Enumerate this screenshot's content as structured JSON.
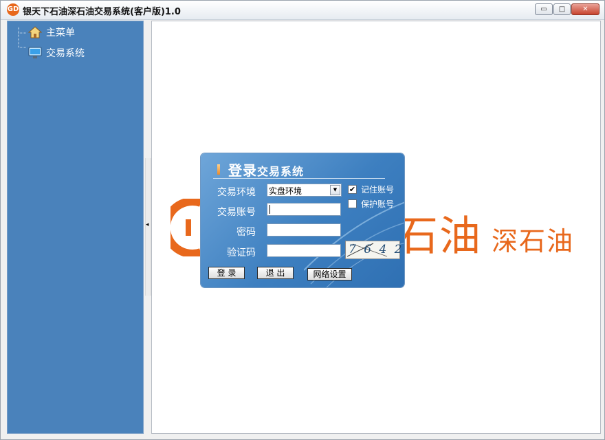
{
  "window": {
    "title": "银天下石油深石油交易系统(客户版)1.0",
    "logo_text": "GD",
    "minimize_glyph": "▭",
    "maximize_glyph": "□",
    "close_glyph": "✕"
  },
  "sidebar": {
    "items": [
      {
        "label": "主菜单",
        "icon": "home-icon"
      },
      {
        "label": "交易系统",
        "icon": "monitor-icon"
      }
    ]
  },
  "splitter": {
    "arrow": "◂"
  },
  "brand": {
    "text1": "石油",
    "text2": "深石油",
    "color": "#e8681c"
  },
  "login": {
    "title_big": "登录",
    "title_small": "交易系统",
    "env_label": "交易环境",
    "env_value": "实盘环境",
    "env_dropdown_glyph": "▼",
    "account_label": "交易账号",
    "account_value": "",
    "password_label": "密码",
    "password_value": "",
    "captcha_label": "验证码",
    "captcha_value": "",
    "captcha_image_text": "7 6 4 2",
    "remember_label": "记住账号",
    "remember_checked": true,
    "remember_mark": "✔",
    "protect_label": "保护账号",
    "protect_checked": false,
    "protect_mark": "",
    "login_button": "登 录",
    "exit_button": "退 出",
    "network_button": "网络设置"
  },
  "colors": {
    "sidebar_bg": "#4a82bb",
    "dialog_bg": "#3d7fc0",
    "accent_orange": "#e8681c"
  }
}
